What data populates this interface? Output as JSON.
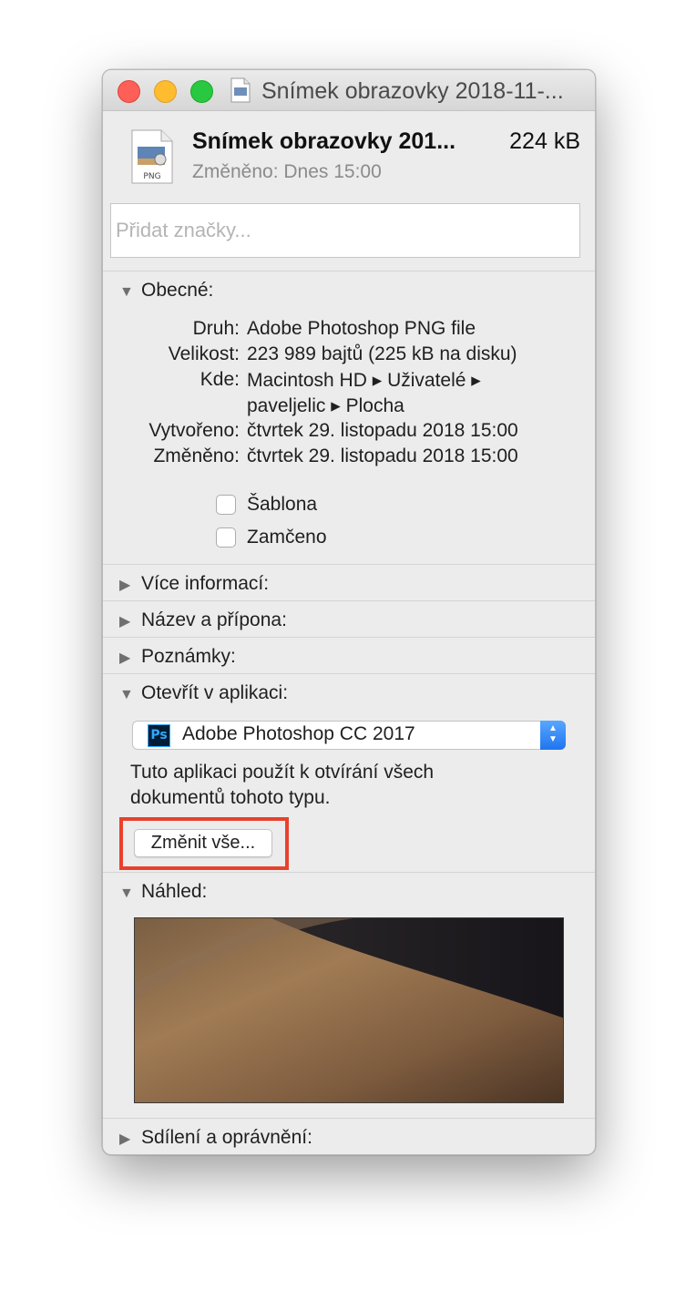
{
  "window": {
    "title": "Snímek obrazovky 2018-11-..."
  },
  "file": {
    "name": "Snímek obrazovky 201...",
    "size": "224 kB",
    "modified": "Změněno: Dnes 15:00",
    "icon_label": "PNG"
  },
  "tags": {
    "placeholder": "Přidat značky..."
  },
  "general": {
    "header": "Obecné:",
    "rows": [
      {
        "label": "Druh:",
        "value": "Adobe Photoshop PNG file"
      },
      {
        "label": "Velikost:",
        "value": "223 989 bajtů (225 kB na disku)"
      },
      {
        "label": "Kde:",
        "value": "Macintosh HD ▸ Uživatelé ▸"
      },
      {
        "label": "",
        "value": "paveljelic ▸ Plocha"
      },
      {
        "label": "Vytvořeno:",
        "value": "čtvrtek 29. listopadu 2018 15:00"
      },
      {
        "label": "Změněno:",
        "value": "čtvrtek 29. listopadu 2018 15:00"
      }
    ],
    "checkboxes": [
      {
        "label": "Šablona",
        "checked": false
      },
      {
        "label": "Zamčeno",
        "checked": false
      }
    ]
  },
  "sections": {
    "more_info": "Více informací:",
    "name_ext": "Název a přípona:",
    "comments": "Poznámky:",
    "open_with": "Otevřít v aplikaci:",
    "preview": "Náhled:",
    "sharing": "Sdílení a oprávnění:"
  },
  "open_with": {
    "app_icon": "Ps",
    "app": "Adobe Photoshop CC 2017",
    "description": "Tuto aplikaci použít k otvírání všech dokumentů tohoto typu.",
    "change_all": "Změnit vše..."
  },
  "colors": {
    "highlight": "#e8412c",
    "stepper": "#2f84f5"
  }
}
